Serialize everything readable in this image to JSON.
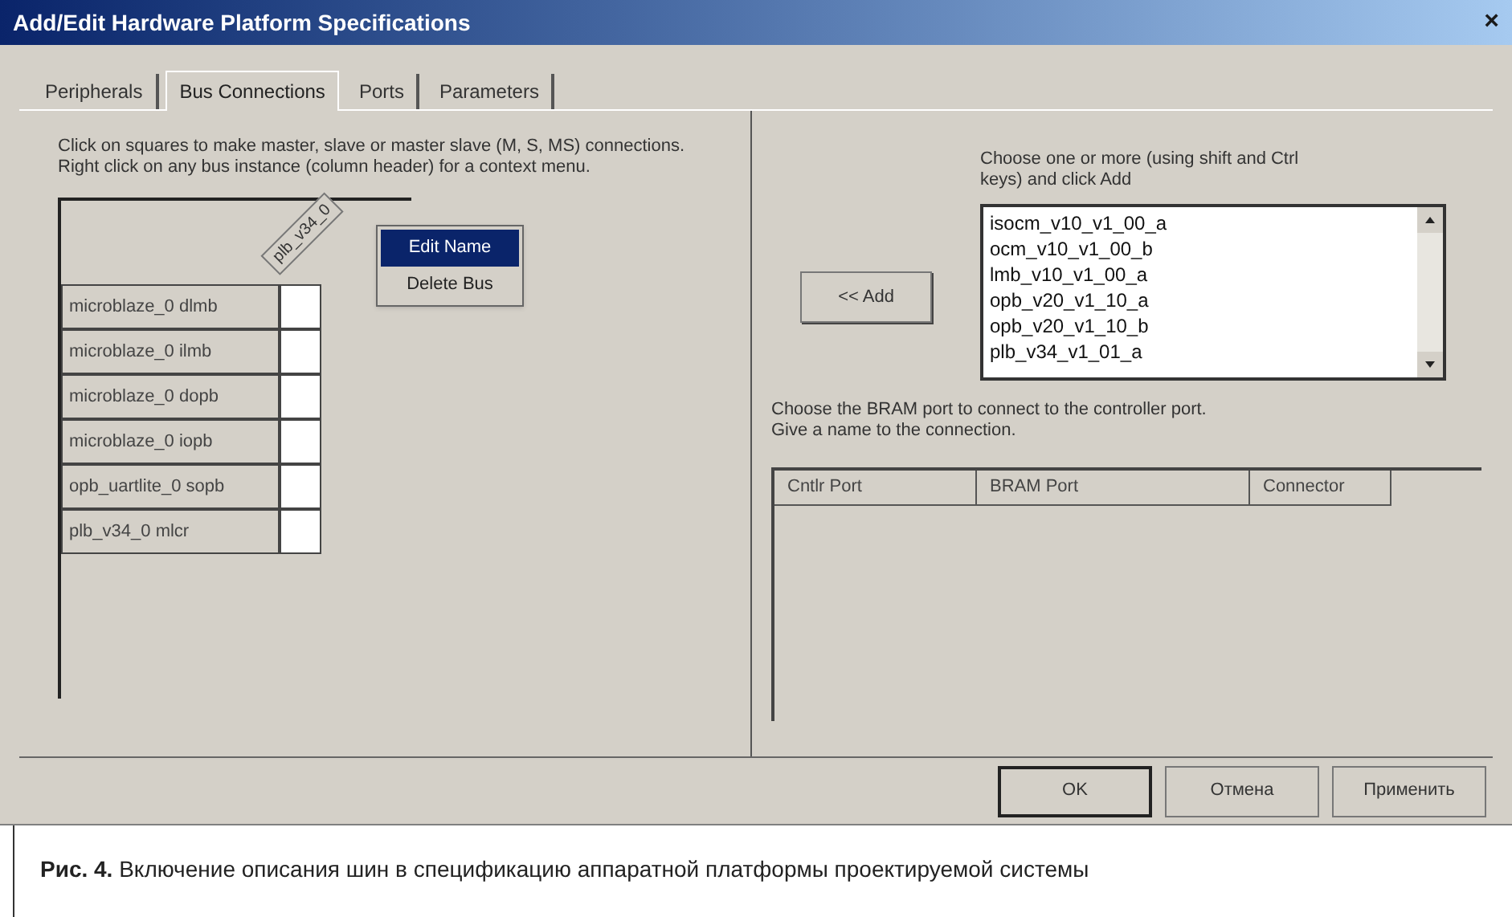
{
  "window": {
    "title": "Add/Edit Hardware Platform Specifications",
    "close": "×"
  },
  "tabs": [
    {
      "label": "Peripherals",
      "selected": false
    },
    {
      "label": "Bus Connections",
      "selected": true
    },
    {
      "label": "Ports",
      "selected": false
    },
    {
      "label": "Parameters",
      "selected": false
    }
  ],
  "instructions": [
    "Click on squares to make master, slave or master slave (M, S, MS) connections.",
    "Right click on any bus instance (column header) for a context menu."
  ],
  "bus_grid": {
    "column_header": "plb_v34_0",
    "rows": [
      "microblaze_0 dlmb",
      "microblaze_0 ilmb",
      "microblaze_0 dopb",
      "microblaze_0 iopb",
      "opb_uartlite_0 sopb",
      "plb_v34_0 mlcr"
    ]
  },
  "context_menu": [
    {
      "label": "Edit Name",
      "selected": true
    },
    {
      "label": "Delete Bus",
      "selected": false
    }
  ],
  "choose_hint": [
    "Choose one or more (using shift and Ctrl",
    "keys) and click Add"
  ],
  "add_button": "<< Add",
  "bus_list": [
    "isocm_v10_v1_00_a",
    "ocm_v10_v1_00_b",
    "lmb_v10_v1_00_a",
    "opb_v20_v1_10_a",
    "opb_v20_v1_10_b",
    "plb_v34_v1_01_a"
  ],
  "bram_hint": [
    "Choose the BRAM port to connect to the controller port.",
    "Give a name to the connection."
  ],
  "bram_table": {
    "columns": [
      "Cntlr Port",
      "BRAM Port",
      "Connector"
    ]
  },
  "buttons": [
    "OK",
    "Отмена",
    "Применить"
  ],
  "caption": "**Рис. 4.** Включение описания шин в спецификацию аппаратной платформы проектируемой системы"
}
